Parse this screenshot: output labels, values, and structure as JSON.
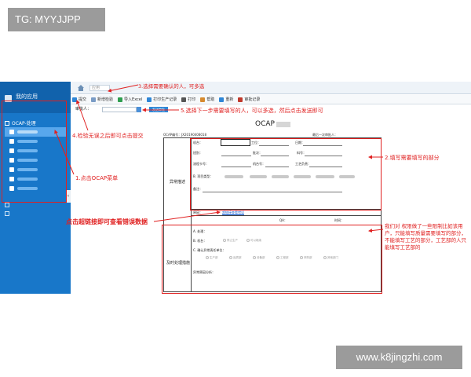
{
  "watermark_top": "TG: MYYJJPP",
  "watermark_bottom": "www.k8jingzhi.com",
  "sidebar": {
    "title": "我的应用",
    "section": "OCAP-处理"
  },
  "tabbar": {
    "tab_label": "应用"
  },
  "toolbar": {
    "buttons": [
      {
        "label": "提交",
        "color": "#2f86d6"
      },
      {
        "label": "新增检验",
        "color": "#7a9cc6"
      },
      {
        "label": "导入Excel",
        "color": "#2e9e4f"
      },
      {
        "label": "打印生产记录",
        "color": "#2f86d6"
      },
      {
        "label": "打印",
        "color": "#555555"
      },
      {
        "label": "帮助",
        "color": "#d68a2f"
      },
      {
        "label": "重新",
        "color": "#2f86d6"
      },
      {
        "label": "审批记录",
        "color": "#c0392b"
      }
    ]
  },
  "approver": {
    "label": "审批人：",
    "send_label": "发送审批"
  },
  "form": {
    "title": "OCAP",
    "ocap_no": "OCAP编号：JX20190408018",
    "last_approver": "最后一次审批人：",
    "section_abnormal": "异常描述",
    "section_action": "及时处理措施",
    "fields": {
      "machine": "机台：",
      "station": "工位：",
      "date": "日期：",
      "shift": "班别：",
      "lot": "批次：",
      "part_no": "料号：",
      "flow_card": "流程卡号：",
      "machine_no": "机台号：",
      "process_owner": "工艺负责：",
      "b_item": "B. 项目类型：",
      "remark": "备注：",
      "reason": "原因：",
      "hyperlink": "超链接查看错误",
      "qa": "QA：",
      "time": "时间：",
      "a_process": "A. 处理：",
      "b_machine": "B. 机台：",
      "c_confirm": "C. 确认异常责任单位：",
      "abnormal_reason": "异常原因分析："
    },
    "options_b_machine": [
      "停止生产",
      "可以继续"
    ],
    "options_c_confirm": [
      "生产部",
      "品质部",
      "设备部",
      "工程部",
      "采购部",
      "其他部门"
    ]
  },
  "annotations": {
    "a1": "1.点击OCAP菜单",
    "a2": "2.填写需要填写的部分",
    "a3": "3.选择需要确认的人，可多选",
    "a4": "4.检验无误之后即可点击提交",
    "a5": "5.选择下一步需要填写的人，可以多选，然后点击发送即可",
    "a6": "点击超链接即可查看错误数据",
    "a7": "我们对       权限做了一些限制比如该用户，只能填写质量需要填写的部分，不能填写工艺的部分，工艺部的人只能填写工艺部的"
  },
  "colors": {
    "annotation": "#e02020",
    "sidebar": "#1877c9",
    "sidebar_active": "#58a7ec"
  }
}
